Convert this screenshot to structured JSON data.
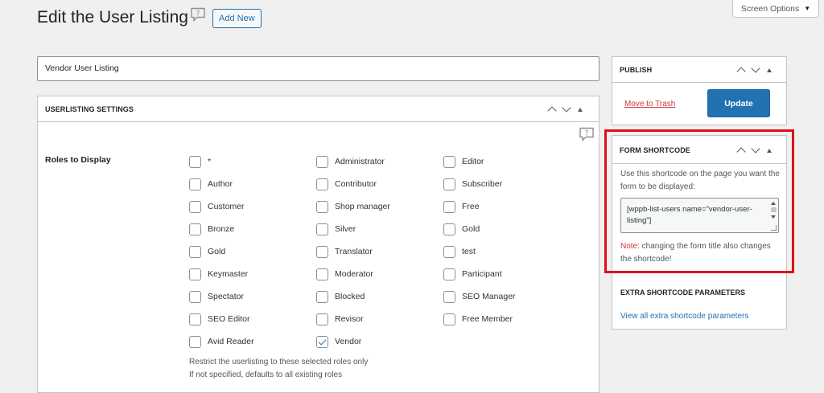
{
  "header": {
    "title": "Edit the User Listing",
    "add_new_label": "Add New",
    "screen_options_label": "Screen Options",
    "help_icon": "help-bubble-icon"
  },
  "title_field": {
    "value": "Vendor User Listing"
  },
  "settings_box": {
    "title": "USERLISTING SETTINGS",
    "roles_label": "Roles to Display",
    "roles": [
      {
        "label": "*",
        "checked": false
      },
      {
        "label": "Administrator",
        "checked": false
      },
      {
        "label": "Editor",
        "checked": false
      },
      {
        "label": "Author",
        "checked": false
      },
      {
        "label": "Contributor",
        "checked": false
      },
      {
        "label": "Subscriber",
        "checked": false
      },
      {
        "label": "Customer",
        "checked": false
      },
      {
        "label": "Shop manager",
        "checked": false
      },
      {
        "label": "Free",
        "checked": false
      },
      {
        "label": "Bronze",
        "checked": false
      },
      {
        "label": "Silver",
        "checked": false
      },
      {
        "label": "Gold",
        "checked": false
      },
      {
        "label": "Gold",
        "checked": false
      },
      {
        "label": "Translator",
        "checked": false
      },
      {
        "label": "test",
        "checked": false
      },
      {
        "label": "Keymaster",
        "checked": false
      },
      {
        "label": "Moderator",
        "checked": false
      },
      {
        "label": "Participant",
        "checked": false
      },
      {
        "label": "Spectator",
        "checked": false
      },
      {
        "label": "Blocked",
        "checked": false
      },
      {
        "label": "SEO Manager",
        "checked": false
      },
      {
        "label": "SEO Editor",
        "checked": false
      },
      {
        "label": "Revisor",
        "checked": false
      },
      {
        "label": "Free Member",
        "checked": false
      },
      {
        "label": "Avid Reader",
        "checked": false
      },
      {
        "label": "Vendor",
        "checked": true
      }
    ],
    "help_lines": [
      "Restrict the userlisting to these selected roles only",
      "If not specified, defaults to all existing roles"
    ]
  },
  "publish_box": {
    "title": "PUBLISH",
    "trash_label": "Move to Trash",
    "update_label": "Update"
  },
  "shortcode_box": {
    "title": "FORM SHORTCODE",
    "description": "Use this shortcode on the page you want the form to be displayed:",
    "shortcode_value": "[wppb-list-users name=\"vendor-user-listing\"]",
    "note_label": "Note:",
    "note_text": " changing the form title also changes the shortcode!",
    "extra_title": "EXTRA SHORTCODE PARAMETERS",
    "extra_link": "View all extra shortcode parameters"
  },
  "colors": {
    "accent": "#2271b1",
    "danger": "#d63638",
    "highlight": "#e30b17",
    "background": "#f0f0f1"
  }
}
